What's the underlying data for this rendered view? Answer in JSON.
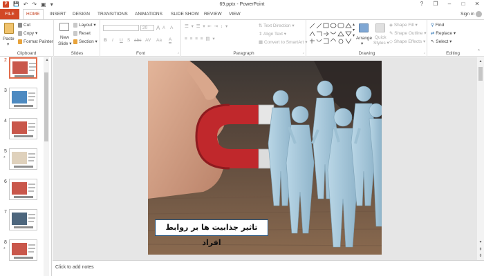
{
  "window": {
    "title": "69.pptx - PowerPoint",
    "controls": {
      "help": "?",
      "restore": "❐",
      "minimize": "–",
      "maximize": "□",
      "close": "✕"
    }
  },
  "qat": {
    "save": "💾",
    "undo": "↶",
    "redo": "↷",
    "start": "▣",
    "customize": "▾"
  },
  "tabs": [
    {
      "label": "FILE"
    },
    {
      "label": "HOME"
    },
    {
      "label": "INSERT"
    },
    {
      "label": "DESIGN"
    },
    {
      "label": "TRANSITIONS"
    },
    {
      "label": "ANIMATIONS"
    },
    {
      "label": "SLIDE SHOW"
    },
    {
      "label": "REVIEW"
    },
    {
      "label": "VIEW"
    }
  ],
  "sign_in": "Sign in",
  "ribbon": {
    "clipboard": {
      "paste": "Paste",
      "cut": "Cut",
      "copy": "Copy",
      "format_painter": "Format Painter",
      "label": "Clipboard"
    },
    "slides": {
      "new_slide_line1": "New",
      "new_slide_line2": "Slide",
      "layout": "Layout",
      "reset": "Reset",
      "section": "Section",
      "label": "Slides"
    },
    "font": {
      "size": "20",
      "bold": "B",
      "italic": "I",
      "underline": "U",
      "shadow": "S",
      "strike": "abc",
      "spacing": "AV",
      "case": "Aa",
      "grow": "A",
      "shrink": "A",
      "clear": "A",
      "color": "A",
      "label": "Font"
    },
    "paragraph": {
      "text_direction": "Text Direction",
      "align_text": "Align Text",
      "smartart": "Convert to SmartArt",
      "label": "Paragraph"
    },
    "drawing": {
      "arrange": "Arrange",
      "quick_styles_line1": "Quick",
      "quick_styles_line2": "Styles",
      "shape_fill": "Shape Fill",
      "shape_outline": "Shape Outline",
      "shape_effects": "Shape Effects",
      "label": "Drawing"
    },
    "editing": {
      "find": "Find",
      "replace": "Replace",
      "select": "Select",
      "label": "Editing"
    }
  },
  "slides_panel": {
    "items": [
      {
        "number": "2",
        "star": "",
        "accent": "#c0392b"
      },
      {
        "number": "3",
        "star": "",
        "accent": "#2e75b6"
      },
      {
        "number": "4",
        "star": "",
        "accent": "#c0392b"
      },
      {
        "number": "5",
        "star": "*",
        "accent": "#d9c9b0"
      },
      {
        "number": "6",
        "star": "",
        "accent": "#c0392b"
      },
      {
        "number": "7",
        "star": "",
        "accent": "#2e4b66"
      },
      {
        "number": "8",
        "star": "*",
        "accent": "#c0392b"
      }
    ]
  },
  "slide": {
    "caption": "تاثیر جذابیت ها بر روابط افراد"
  },
  "notes": {
    "placeholder": "Click to add notes"
  },
  "colors": {
    "accent": "#d24726",
    "tab_active": "#c43e1c",
    "thumb_border": "#e26c4b"
  }
}
